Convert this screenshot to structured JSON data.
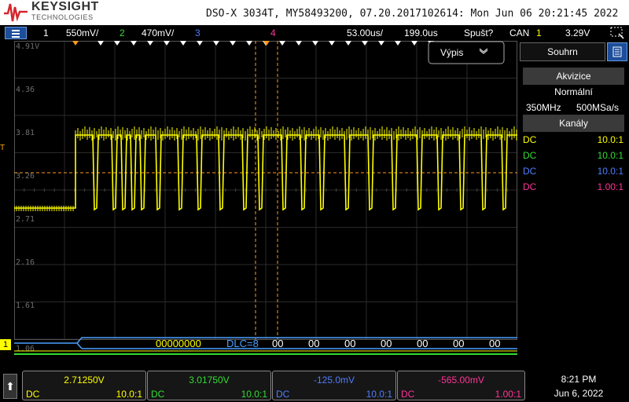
{
  "header": {
    "brand": "KEYSIGHT",
    "brand_sub": "TECHNOLOGIES",
    "model_line": "DSO-X 3034T, MY58493200, 07.20.2017102614: Mon Jun 06 20:21:45 2022"
  },
  "topbar": {
    "ch1_num": "1",
    "ch1_scale": "550mV/",
    "ch2_num": "2",
    "ch2_scale": "470mV/",
    "ch3_num": "3",
    "ch4_num": "4",
    "timebase": "53.00us/",
    "delay": "199.0us",
    "trigger_mode": "Spušt?",
    "trigger_type": "CAN",
    "trigger_src": "1",
    "trigger_level": "3.29V"
  },
  "grid": {
    "volt_labels": [
      "4.91V",
      "4.36",
      "3.81",
      "3.26",
      "2.71",
      "2.16",
      "1.61",
      "1.06"
    ],
    "trigger_marker": "T",
    "ch1_marker": "1",
    "vypis_label": "Výpis",
    "decode": {
      "id": "00000000",
      "dlc": "DLC=8",
      "bytes": [
        "00",
        "00",
        "00",
        "00",
        "00",
        "00",
        "00"
      ]
    }
  },
  "panel": {
    "souhrn_tab": "Souhrn",
    "akvizice_head": "Akvizice",
    "mode": "Normální",
    "bandwidth": "350MHz",
    "sample_rate": "500MSa/s",
    "kanaly_head": "Kanály",
    "channels": [
      {
        "coupling": "DC",
        "ratio": "10.0:1",
        "color": "#ffff00"
      },
      {
        "coupling": "DC",
        "ratio": "10.0:1",
        "color": "#33dd33"
      },
      {
        "coupling": "DC",
        "ratio": "10.0:1",
        "color": "#4f7dff"
      },
      {
        "coupling": "DC",
        "ratio": "1.00:1",
        "color": "#ff3399"
      }
    ]
  },
  "bottom": {
    "channels": [
      {
        "value": "2.71250V",
        "coupling": "DC",
        "ratio": "10.0:1",
        "color": "#ffff00"
      },
      {
        "value": "3.01750V",
        "coupling": "DC",
        "ratio": "10.0:1",
        "color": "#33dd33"
      },
      {
        "value": "-125.0mV",
        "coupling": "DC",
        "ratio": "10.0:1",
        "color": "#4f7dff"
      },
      {
        "value": "-565.00mV",
        "coupling": "DC",
        "ratio": "1.00:1",
        "color": "#ff3399"
      }
    ],
    "time": "8:21 PM",
    "date": "Jun 6, 2022"
  },
  "colors": {
    "ch1": "#ffff00",
    "ch2": "#33dd33",
    "ch3": "#4f7dff",
    "ch4": "#ff3399",
    "trigger_line": "#ff9a1a",
    "decode_bus": "#4aa0ff",
    "grid": "#2a2a2a"
  }
}
